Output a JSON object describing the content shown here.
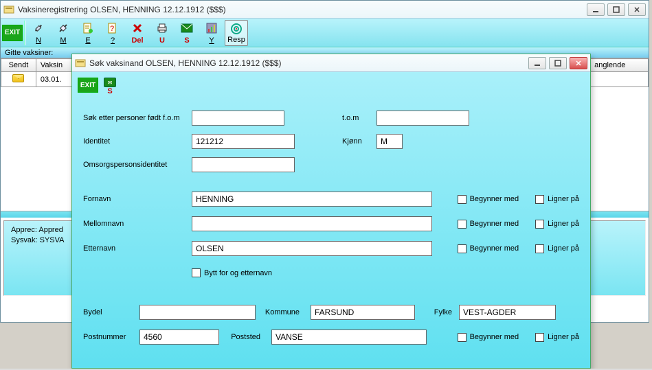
{
  "main": {
    "title": "Vaksineregistrering OLSEN, HENNING 12.12.1912 ($$$)",
    "exit_label": "EXIT",
    "toolbar": [
      {
        "label": "N",
        "icon": "needle-icon"
      },
      {
        "label": "M",
        "icon": "syringe-icon"
      },
      {
        "label": "E",
        "icon": "form-edit-icon"
      },
      {
        "label": "?",
        "icon": "form-help-icon"
      },
      {
        "label": "Del",
        "icon": "delete-x-icon",
        "red": true
      },
      {
        "label": "U",
        "icon": "print-icon",
        "red": true
      },
      {
        "label": "S",
        "icon": "envelope-green-icon",
        "red": true
      },
      {
        "label": "Y",
        "icon": "chart-icon"
      },
      {
        "label": "Resp",
        "icon": "target-icon",
        "boxed": true,
        "nou": true
      }
    ],
    "sub_strip": "Gitte  vaksiner:",
    "table": {
      "headers": [
        "Sendt",
        "Vaksin",
        "anglende"
      ],
      "rows": [
        {
          "sendt_icon": "yellow-envelope-icon",
          "date": "03.01."
        }
      ]
    },
    "footer": [
      "Apprec: Appred",
      "Sysvak: SYSVA"
    ]
  },
  "dialog": {
    "title": "Søk vaksinand OLSEN, HENNING 12.12.1912 ($$$)",
    "exit_label": "EXIT",
    "s_label": "S",
    "fields": {
      "fom_label": "Søk etter personer født f.o.m",
      "fom_value": "",
      "tom_label": "t.o.m",
      "tom_value": "",
      "identitet_label": "Identitet",
      "identitet_value": "121212",
      "kjonn_label": "Kjønn",
      "kjonn_value": "M",
      "omsorgs_label": "Omsorgspersonsidentitet",
      "omsorgs_value": "",
      "fornavn_label": "Fornavn",
      "fornavn_value": "HENNING",
      "mellomnavn_label": "Mellomnavn",
      "mellomnavn_value": "",
      "etternavn_label": "Etternavn",
      "etternavn_value": "OLSEN",
      "swap_label": "Bytt for og etternavn",
      "bydel_label": "Bydel",
      "bydel_value": "",
      "kommune_label": "Kommune",
      "kommune_value": "FARSUND",
      "fylke_label": "Fylke",
      "fylke_value": "VEST-AGDER",
      "postnr_label": "Postnummer",
      "postnr_value": "4560",
      "poststed_label": "Poststed",
      "poststed_value": "VANSE",
      "begynner_label": "Begynner med",
      "ligner_label": "Ligner på"
    }
  }
}
